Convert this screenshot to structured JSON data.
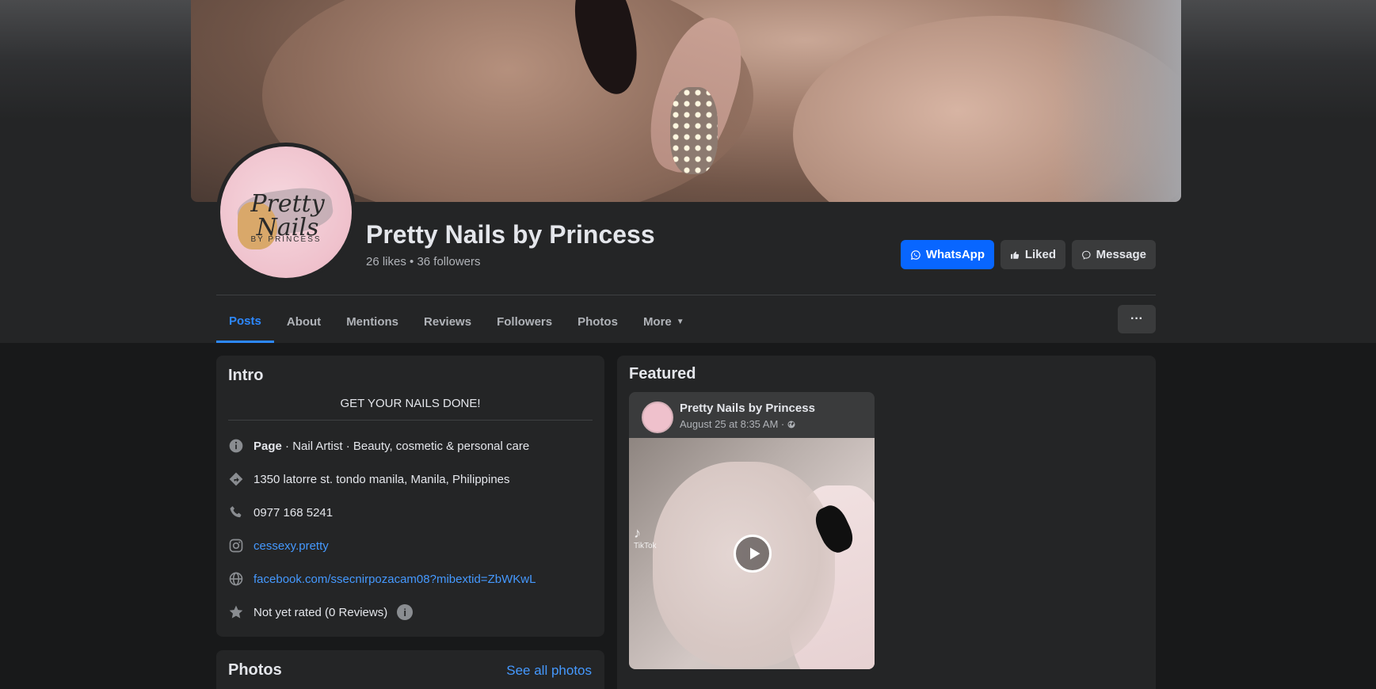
{
  "page": {
    "name": "Pretty Nails by Princess",
    "stats": "26 likes • 36 followers",
    "avatar_logo_text": "Pretty Nails",
    "avatar_logo_sub": "BY PRINCESS"
  },
  "actions": {
    "whatsapp": "WhatsApp",
    "liked": "Liked",
    "message": "Message",
    "more_dots": "···"
  },
  "tabs": [
    {
      "label": "Posts",
      "active": true
    },
    {
      "label": "About"
    },
    {
      "label": "Mentions"
    },
    {
      "label": "Reviews"
    },
    {
      "label": "Followers"
    },
    {
      "label": "Photos"
    },
    {
      "label": "More"
    }
  ],
  "intro": {
    "title": "Intro",
    "bio": "GET YOUR NAILS DONE!",
    "category_bold": "Page",
    "category_rest": " · Nail Artist · Beauty, cosmetic & personal care",
    "address": "1350 latorre st. tondo manila, Manila, Philippines",
    "phone": "0977 168 5241",
    "instagram": "cessexy.pretty",
    "website": "facebook.com/ssecnirpozacam08?mibextid=ZbWKwL",
    "rating": "Not yet rated (0 Reviews)"
  },
  "photos": {
    "title": "Photos",
    "see_all": "See all photos"
  },
  "featured": {
    "title": "Featured",
    "post": {
      "author": "Pretty Nails by Princess",
      "date": "August 25 at 8:35 AM ·",
      "watermark": "TikTok"
    }
  },
  "colors": {
    "accent": "#0866ff",
    "link": "#4599ff",
    "background": "#18191a",
    "card": "#242526"
  }
}
